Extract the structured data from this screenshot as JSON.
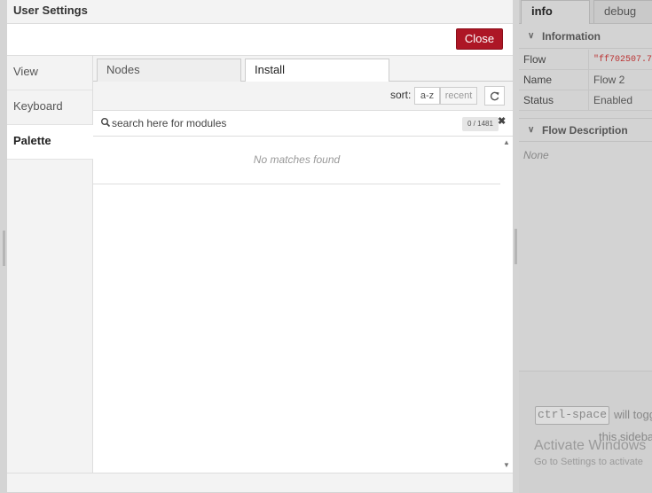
{
  "dialog": {
    "title": "User Settings",
    "close_label": "Close",
    "nav": [
      {
        "label": "View"
      },
      {
        "label": "Keyboard"
      },
      {
        "label": "Palette"
      }
    ],
    "active_nav": "Palette",
    "tabs": [
      {
        "label": "Nodes"
      },
      {
        "label": "Install"
      }
    ],
    "active_tab": "Install",
    "toolbar": {
      "sort_label": "sort:",
      "sort_az": "a-z",
      "sort_recent": "recent",
      "refresh_icon": "refresh-icon"
    },
    "search": {
      "placeholder": "search here for modules",
      "value": "",
      "count": "0 / 1481",
      "clear_icon": "close-icon"
    },
    "results": {
      "empty_text": "No matches found"
    }
  },
  "sidebar": {
    "tabs": [
      {
        "label": "info"
      },
      {
        "label": "debug"
      }
    ],
    "active_tab": "info",
    "information": {
      "heading": "Information",
      "rows": [
        {
          "key": "Flow",
          "value": "\"ff702507.7"
        },
        {
          "key": "Name",
          "value": "Flow 2"
        },
        {
          "key": "Status",
          "value": "Enabled"
        }
      ]
    },
    "flow_description": {
      "heading": "Flow Description",
      "text": "None"
    },
    "hint": {
      "kbd": "ctrl-space",
      "text1": "will togg",
      "text2": "this sideba"
    },
    "watermark": {
      "title": "Activate Windows",
      "subtitle": "Go to Settings to activate"
    }
  },
  "colors": {
    "close_button": "#ad1625",
    "sidebar_bg": "#d3d3d3"
  }
}
